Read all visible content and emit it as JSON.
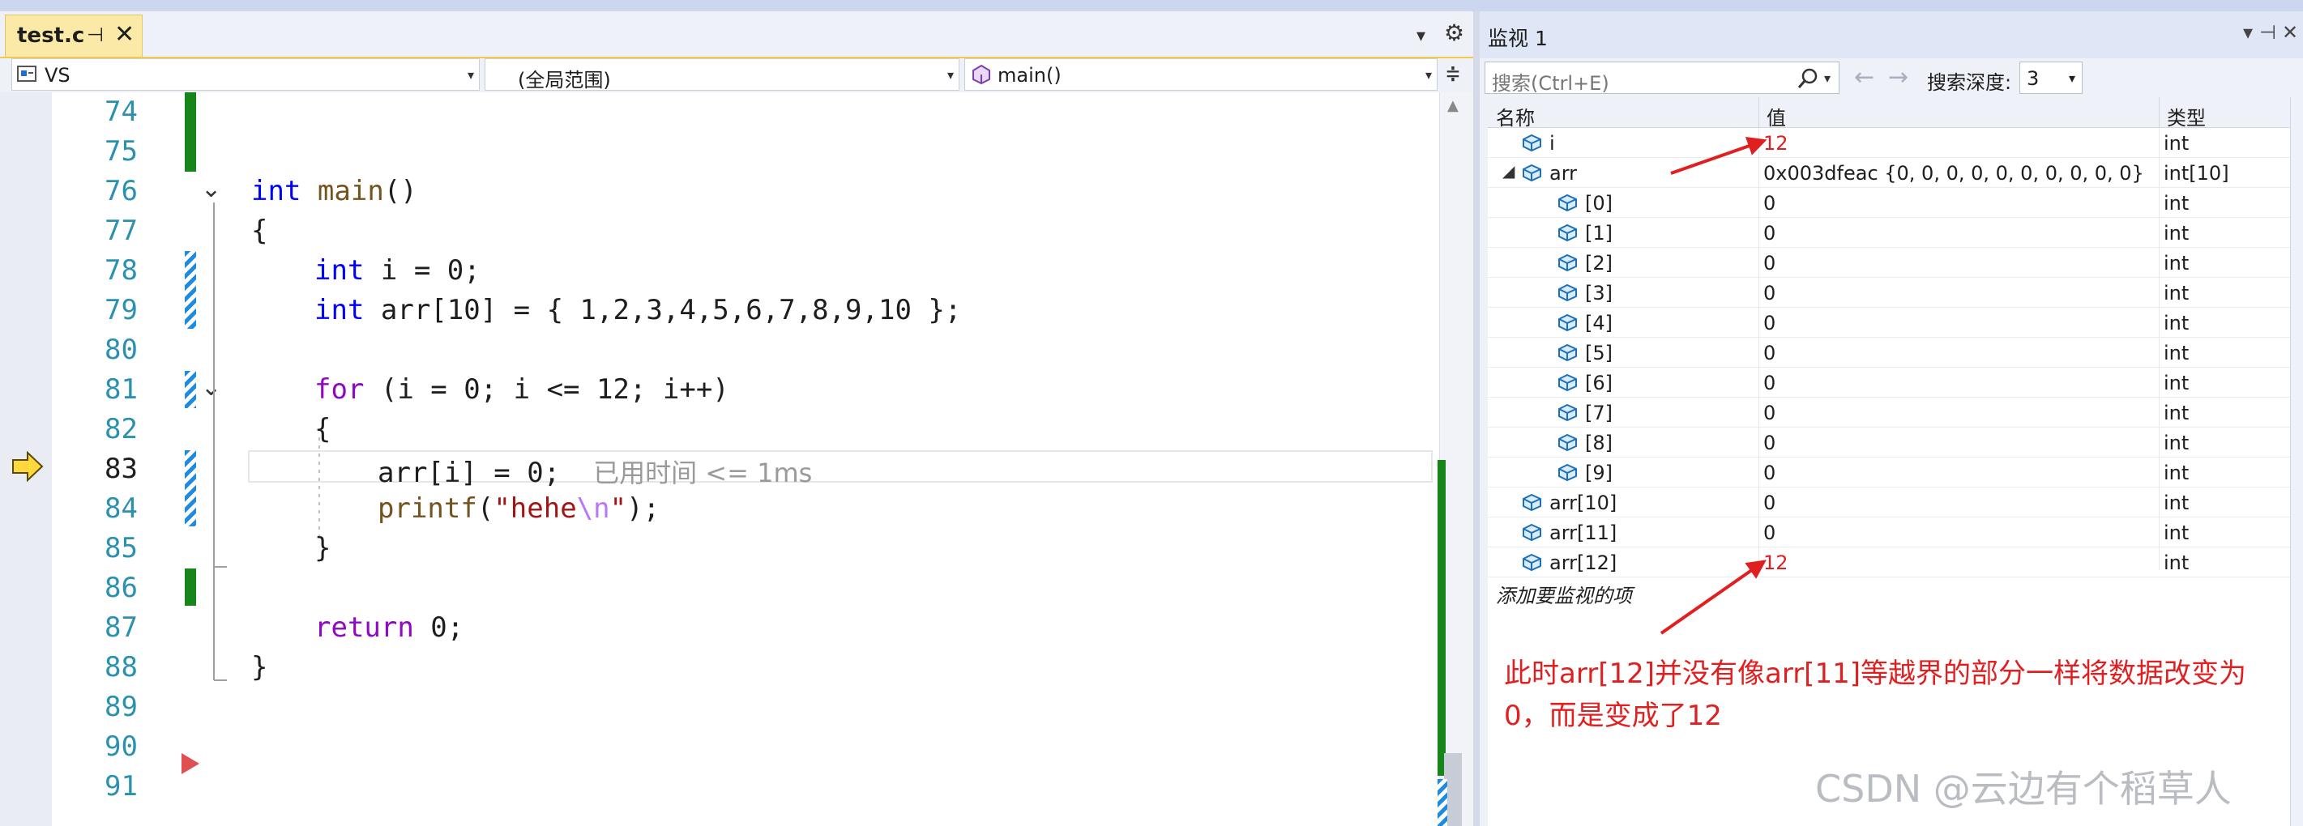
{
  "editor": {
    "tab": {
      "name": "test.c",
      "pin": "⊣",
      "close": "✕"
    },
    "nav": {
      "project": "VS",
      "scope": "(全局范围)",
      "member": "main()"
    },
    "current_line": 83,
    "lines": [
      {
        "n": "74"
      },
      {
        "n": "75"
      },
      {
        "n": "76"
      },
      {
        "n": "77"
      },
      {
        "n": "78"
      },
      {
        "n": "79"
      },
      {
        "n": "80"
      },
      {
        "n": "81"
      },
      {
        "n": "82"
      },
      {
        "n": "83"
      },
      {
        "n": "84"
      },
      {
        "n": "85"
      },
      {
        "n": "86"
      },
      {
        "n": "87"
      },
      {
        "n": "88"
      },
      {
        "n": "89"
      },
      {
        "n": "90"
      },
      {
        "n": "91"
      }
    ],
    "code": {
      "l76_kw": "int",
      "l76_fn": "main",
      "l76_rest": "()",
      "l77": "{",
      "l78_kw": "int",
      "l78_rest": " i = 0;",
      "l79_kw": "int",
      "l79_rest": " arr[10] = { 1,2,3,4,5,6,7,8,9,10 };",
      "l81_kw": "for",
      "l81_rest": " (i = 0; i <= 12; i++)",
      "l82": "{",
      "l83_code": "arr[i] = 0;",
      "l83_hint": "已用时间 <= 1ms",
      "l84_fn": "printf",
      "l84_p1": "(",
      "l84_str": "\"hehe",
      "l84_esc": "\\n",
      "l84_str2": "\"",
      "l84_end": ");",
      "l85": "}",
      "l87_kw": "return",
      "l87_rest": " 0;",
      "l88": "}"
    }
  },
  "watch": {
    "title": "监视 1",
    "search_placeholder": "搜索(Ctrl+E)",
    "search_depth_label": "搜索深度:",
    "search_depth_value": "3",
    "columns": {
      "name": "名称",
      "value": "值",
      "type": "类型"
    },
    "rows": [
      {
        "name": "i",
        "value": "12",
        "type": "int",
        "changed": true,
        "level": 0
      },
      {
        "name": "arr",
        "value": "0x003dfeac {0, 0, 0, 0, 0, 0, 0, 0, 0, 0}",
        "type": "int[10]",
        "expanded": true,
        "level": 0
      },
      {
        "name": "[0]",
        "value": "0",
        "type": "int",
        "level": 1
      },
      {
        "name": "[1]",
        "value": "0",
        "type": "int",
        "level": 1
      },
      {
        "name": "[2]",
        "value": "0",
        "type": "int",
        "level": 1
      },
      {
        "name": "[3]",
        "value": "0",
        "type": "int",
        "level": 1
      },
      {
        "name": "[4]",
        "value": "0",
        "type": "int",
        "level": 1
      },
      {
        "name": "[5]",
        "value": "0",
        "type": "int",
        "level": 1
      },
      {
        "name": "[6]",
        "value": "0",
        "type": "int",
        "level": 1
      },
      {
        "name": "[7]",
        "value": "0",
        "type": "int",
        "level": 1
      },
      {
        "name": "[8]",
        "value": "0",
        "type": "int",
        "level": 1
      },
      {
        "name": "[9]",
        "value": "0",
        "type": "int",
        "level": 1
      },
      {
        "name": "arr[10]",
        "value": "0",
        "type": "int",
        "level": 0
      },
      {
        "name": "arr[11]",
        "value": "0",
        "type": "int",
        "level": 0
      },
      {
        "name": "arr[12]",
        "value": "12",
        "type": "int",
        "changed": true,
        "level": 0
      }
    ],
    "add_item": "添加要监视的项"
  },
  "annotation": "此时arr[12]并没有像arr[11]等越界的部分一样将数据改变为0，而是变成了12",
  "watermark": "CSDN @云边有个稻草人",
  "colors": {
    "changed_value": "#e02020",
    "keyword": "#0000ff",
    "control_keyword": "#8f08c4",
    "change_bar": "#16861a",
    "tab_active": "#fbe9a7"
  },
  "icons": [
    "solution-icon",
    "class-member-icon",
    "exec-pointer-icon",
    "breakpoint-marker",
    "watch-variable-icon",
    "search-icon",
    "back-arrow-icon",
    "forward-arrow-icon",
    "settings-gear-icon",
    "pin-icon",
    "close-icon"
  ]
}
